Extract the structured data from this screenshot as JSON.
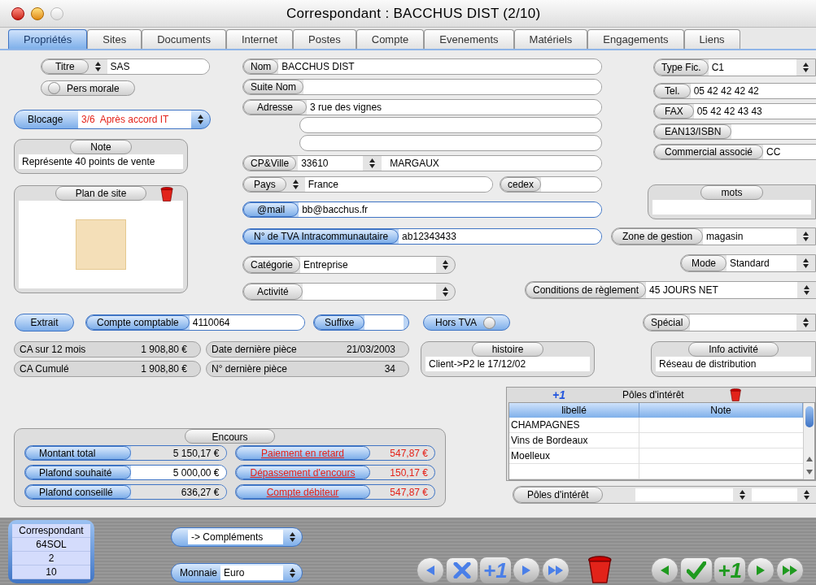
{
  "window": {
    "title": "Correspondant : BACCHUS DIST (2/10)"
  },
  "tabs": [
    {
      "label": "Propriétés",
      "selected": true
    },
    {
      "label": "Sites",
      "selected": false
    },
    {
      "label": "Documents",
      "selected": false
    },
    {
      "label": "Internet",
      "selected": false
    },
    {
      "label": "Postes",
      "selected": false
    },
    {
      "label": "Compte",
      "selected": false
    },
    {
      "label": "Evenements",
      "selected": false
    },
    {
      "label": "Matériels",
      "selected": false
    },
    {
      "label": "Engagements",
      "selected": false
    },
    {
      "label": "Liens",
      "selected": false
    }
  ],
  "left": {
    "titre": {
      "label": "Titre",
      "value": "SAS"
    },
    "pers_morale": {
      "label": "Pers morale",
      "checked": false
    },
    "blocage": {
      "label": "Blocage",
      "value": "3/6  Après accord IT"
    },
    "note": {
      "title": "Note",
      "value": "Représente 40 points de vente"
    },
    "site_plan": {
      "title": "Plan de site"
    }
  },
  "middle": {
    "nom": {
      "label": "Nom",
      "value": "BACCHUS DIST"
    },
    "suite_nom": {
      "label": "Suite Nom"
    },
    "adresse": {
      "label": "Adresse",
      "value": "3 rue des vignes"
    },
    "cp_ville": {
      "label": "CP&Ville",
      "postcode": "33610",
      "city": "MARGAUX"
    },
    "pays": {
      "label": "Pays",
      "value": "France"
    },
    "cedex": {
      "label": "cedex"
    },
    "mail": {
      "label": "@mail",
      "value": "bb@bacchus.fr"
    },
    "tva": {
      "label": "N° de TVA Intracommunautaire",
      "value": "ab12343433"
    },
    "categorie": {
      "label": "Catégorie",
      "value": "Entreprise"
    },
    "activite": {
      "label": "Activité"
    }
  },
  "right": {
    "type_fic": {
      "label": "Type Fic.",
      "value": "C1"
    },
    "contacts": [
      {
        "label": "Tel.",
        "value": "05 42 42 42 42"
      },
      {
        "label": "FAX",
        "value": "05 42 42 43 43"
      },
      {
        "label": "EAN13/ISBN"
      },
      {
        "label": "Commercial associé",
        "value": "CC"
      }
    ],
    "mots": {
      "title": "mots"
    },
    "zone": {
      "label": "Zone de gestion",
      "value": "magasin"
    },
    "mode": {
      "label": "Mode",
      "value": "Standard"
    },
    "conditions": {
      "label": "Conditions de règlement",
      "value": "45 JOURS NET"
    }
  },
  "accounting": {
    "extrait": "Extrait",
    "compte": {
      "label": "Compte comptable",
      "value": "4110064"
    },
    "suffixe": {
      "label": "Suffixe"
    },
    "hors_tva": {
      "label": "Hors TVA",
      "checked": false
    },
    "special": {
      "label": "Spécial"
    }
  },
  "stats": [
    {
      "label": "CA sur 12 mois",
      "value": "1 908,80 €"
    },
    {
      "label": "CA Cumulé",
      "value": "1 908,80 €"
    },
    {
      "label": "Date dernière pièce",
      "value": "21/03/2003"
    },
    {
      "label": "N° dernière pièce",
      "value": "34"
    }
  ],
  "histoire": {
    "title": "histoire",
    "value": "Client->P2 le 17/12/02"
  },
  "info_activite": {
    "title": "Info activité",
    "value": "Réseau de distribution"
  },
  "encours": {
    "title": "Encours",
    "rows": [
      {
        "label": "Montant total",
        "value": "5 150,17 €",
        "editable": false
      },
      {
        "label": "Plafond souhaité",
        "value": "5 000,00 €",
        "editable": true
      },
      {
        "label": "Plafond conseillé",
        "value": "636,27 €",
        "editable": false
      }
    ],
    "alerts": [
      {
        "label": "Paiement en retard",
        "value": "547,87 €"
      },
      {
        "label": "Dépassement d'encours",
        "value": "150,17 €"
      },
      {
        "label": "Compte débiteur",
        "value": "547,87 €"
      }
    ]
  },
  "poles": {
    "add": "+1",
    "title": "Pôles d'intérêt",
    "columns": [
      "libellé",
      "Note"
    ],
    "rows": [
      {
        "libelle": "CHAMPAGNES"
      },
      {
        "libelle": "Vins de Bordeaux"
      },
      {
        "libelle": "Moelleux"
      }
    ],
    "filter_label": "Pôles d'intérêt"
  },
  "footer": {
    "record": [
      "Correspondant",
      "64SOL",
      "2",
      "10"
    ],
    "complements": "-> Compléments",
    "monnaie": {
      "label": "Monnaie",
      "value": "Euro"
    },
    "nav_left": [
      {
        "kind": "prev"
      },
      {
        "kind": "cancel"
      },
      {
        "kind": "add",
        "label": "+1"
      },
      {
        "kind": "next"
      },
      {
        "kind": "last"
      }
    ],
    "nav_right": [
      {
        "kind": "prev"
      },
      {
        "kind": "confirm"
      },
      {
        "kind": "add",
        "label": "+1"
      },
      {
        "kind": "next"
      },
      {
        "kind": "last"
      }
    ]
  }
}
